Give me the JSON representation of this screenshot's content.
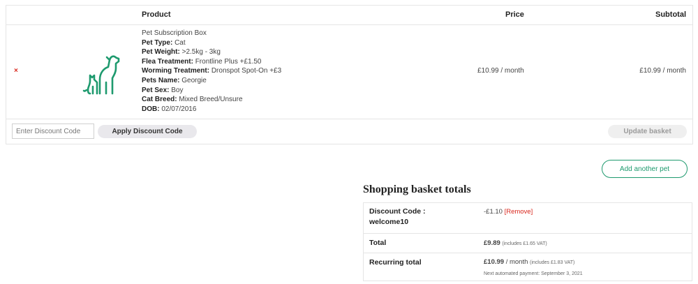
{
  "cart": {
    "headers": {
      "product": "Product",
      "price": "Price",
      "subtotal": "Subtotal"
    },
    "item": {
      "remove_symbol": "×",
      "image_icon": "dog-and-cat-icon",
      "name": "Pet Subscription Box",
      "attributes": [
        {
          "label": "Pet Type:",
          "value": "Cat"
        },
        {
          "label": "Pet Weight:",
          "value": ">2.5kg - 3kg"
        },
        {
          "label": "Flea Treatment:",
          "value": "Frontline Plus +£1.50"
        },
        {
          "label": "Worming Treatment:",
          "value": "Dronspot Spot-On +£3"
        },
        {
          "label": "Pets Name:",
          "value": "Georgie"
        },
        {
          "label": "Pet Sex:",
          "value": "Boy"
        },
        {
          "label": "Cat Breed:",
          "value": "Mixed Breed/Unsure"
        },
        {
          "label": "DOB:",
          "value": "02/07/2016"
        }
      ],
      "price": "£10.99 / month",
      "subtotal": "£10.99 / month"
    },
    "discount_placeholder": "Enter Discount Code",
    "apply_label": "Apply Discount Code",
    "update_label": "Update basket"
  },
  "add_pet_label": "Add another pet",
  "totals": {
    "title": "Shopping basket totals",
    "discount": {
      "label_line1": "Discount Code :",
      "label_line2": "welcome10",
      "amount": "-£1.10",
      "remove": "[Remove]"
    },
    "total": {
      "label": "Total",
      "amount": "£9.89",
      "vat": "(includes £1.65 VAT)"
    },
    "recurring": {
      "label": "Recurring total",
      "amount": "£10.99",
      "period": " / month",
      "vat": "(includes £1.83 VAT)",
      "next_payment": "Next automated payment: September 3, 2021"
    }
  },
  "colors": {
    "accent": "#1e9a6e",
    "remove": "#d9281e"
  }
}
